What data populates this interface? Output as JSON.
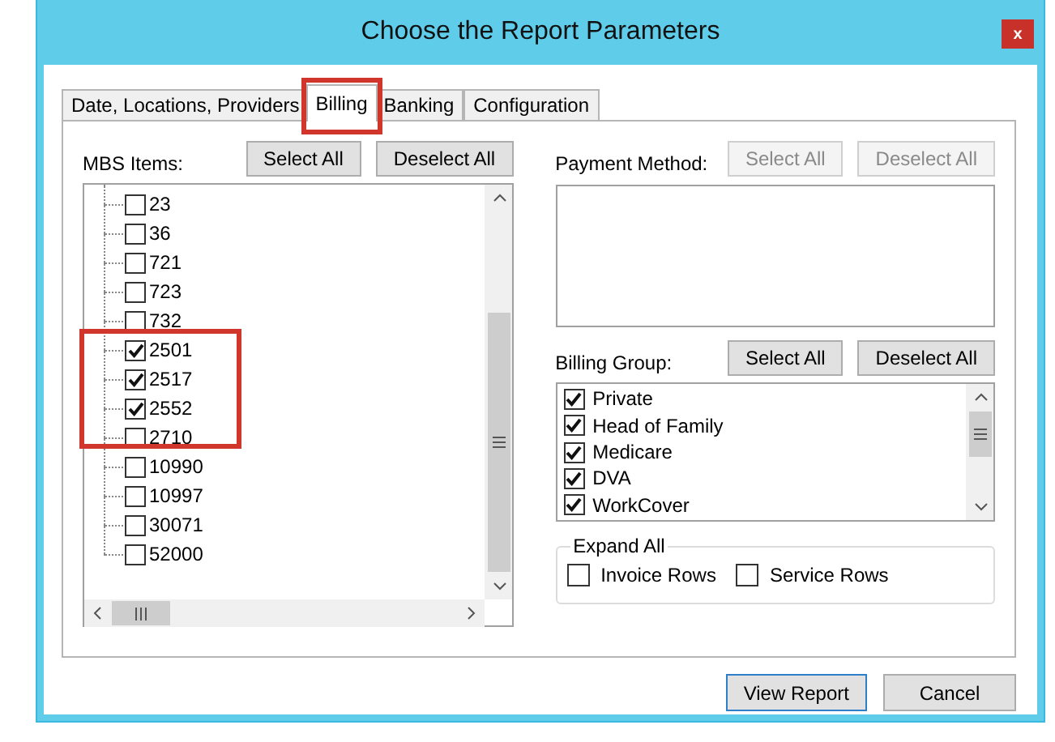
{
  "window": {
    "title": "Choose the Report Parameters",
    "close": "x"
  },
  "tabs": [
    {
      "label": "Date, Locations, Providers",
      "selected": false,
      "highlighted": false
    },
    {
      "label": "Billing",
      "selected": true,
      "highlighted": true
    },
    {
      "label": "Banking",
      "selected": false,
      "highlighted": false
    },
    {
      "label": "Configuration",
      "selected": false,
      "highlighted": false
    }
  ],
  "mbs": {
    "label": "MBS Items:",
    "buttons": [
      {
        "label": "Select All",
        "disabled": false
      },
      {
        "label": "Deselect All",
        "disabled": false
      }
    ],
    "items": [
      {
        "label": "23",
        "checked": false,
        "highlighted": false
      },
      {
        "label": "36",
        "checked": false,
        "highlighted": false
      },
      {
        "label": "721",
        "checked": false,
        "highlighted": false
      },
      {
        "label": "723",
        "checked": false,
        "highlighted": false
      },
      {
        "label": "732",
        "checked": false,
        "highlighted": false
      },
      {
        "label": "2501",
        "checked": true,
        "highlighted": true
      },
      {
        "label": "2517",
        "checked": true,
        "highlighted": true
      },
      {
        "label": "2552",
        "checked": true,
        "highlighted": true
      },
      {
        "label": "2710",
        "checked": false,
        "highlighted": true
      },
      {
        "label": "10990",
        "checked": false,
        "highlighted": false
      },
      {
        "label": "10997",
        "checked": false,
        "highlighted": false
      },
      {
        "label": "30071",
        "checked": false,
        "highlighted": false
      },
      {
        "label": "52000",
        "checked": false,
        "highlighted": false
      }
    ]
  },
  "payment": {
    "label": "Payment Method:",
    "buttons": [
      {
        "label": "Select All",
        "disabled": true
      },
      {
        "label": "Deselect All",
        "disabled": true
      }
    ]
  },
  "billing_group": {
    "label": "Billing Group:",
    "buttons": [
      {
        "label": "Select All",
        "disabled": false
      },
      {
        "label": "Deselect All",
        "disabled": false
      }
    ],
    "items": [
      {
        "label": "Private",
        "checked": true
      },
      {
        "label": "Head of Family",
        "checked": true
      },
      {
        "label": "Medicare",
        "checked": true
      },
      {
        "label": "DVA",
        "checked": true
      },
      {
        "label": "WorkCover",
        "checked": true
      }
    ]
  },
  "expand_all": {
    "legend": "Expand All",
    "options": [
      {
        "label": "Invoice Rows",
        "checked": false
      },
      {
        "label": "Service Rows",
        "checked": false
      }
    ]
  },
  "footer_buttons": [
    {
      "label": "View Report",
      "default": true
    },
    {
      "label": "Cancel",
      "default": false
    }
  ]
}
